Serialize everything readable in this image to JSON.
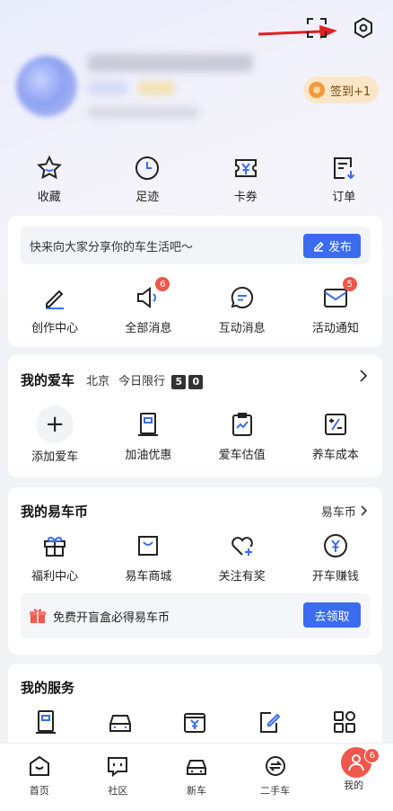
{
  "signin": {
    "label": "签到+1"
  },
  "quick": [
    {
      "label": "收藏",
      "icon": "star-icon"
    },
    {
      "label": "足迹",
      "icon": "clock-icon"
    },
    {
      "label": "卡券",
      "icon": "coupon-icon"
    },
    {
      "label": "订单",
      "icon": "order-icon"
    }
  ],
  "share": {
    "prompt": "快来向大家分享你的车生活吧～",
    "publish_label": "发布"
  },
  "messages": [
    {
      "label": "创作中心",
      "icon": "pen-icon",
      "badge": ""
    },
    {
      "label": "全部消息",
      "icon": "speaker-icon",
      "badge": "6"
    },
    {
      "label": "互动消息",
      "icon": "chat-icon",
      "badge": ""
    },
    {
      "label": "活动通知",
      "icon": "mail-icon",
      "badge": "5"
    }
  ],
  "my_car": {
    "title": "我的爱车",
    "city": "北京",
    "limit_label": "今日限行",
    "limit_numbers": [
      "5",
      "0"
    ],
    "items": [
      {
        "label": "添加爱车",
        "icon": "plus-icon"
      },
      {
        "label": "加油优惠",
        "icon": "fuel-icon"
      },
      {
        "label": "爱车估值",
        "icon": "valuation-icon"
      },
      {
        "label": "养车成本",
        "icon": "calculator-icon"
      }
    ]
  },
  "coins": {
    "title": "我的易车币",
    "link_label": "易车币",
    "items": [
      {
        "label": "福利中心",
        "icon": "gift-icon"
      },
      {
        "label": "易车商城",
        "icon": "shopping-bag-icon"
      },
      {
        "label": "关注有奖",
        "icon": "heart-plus-icon"
      },
      {
        "label": "开车赚钱",
        "icon": "yen-coin-icon"
      }
    ],
    "promo_text": "免费开盲盒必得易车币",
    "promo_button": "去领取"
  },
  "services": {
    "title": "我的服务"
  },
  "bottom_nav": [
    {
      "label": "首页",
      "icon": "home-icon"
    },
    {
      "label": "社区",
      "icon": "community-icon"
    },
    {
      "label": "新车",
      "icon": "car-icon"
    },
    {
      "label": "二手车",
      "icon": "exchange-icon"
    },
    {
      "label": "我的",
      "icon": "user-icon",
      "badge": "6"
    }
  ],
  "colors": {
    "accent": "#3b6cf0",
    "badge": "#f0564a",
    "arrow": "#e02020"
  }
}
